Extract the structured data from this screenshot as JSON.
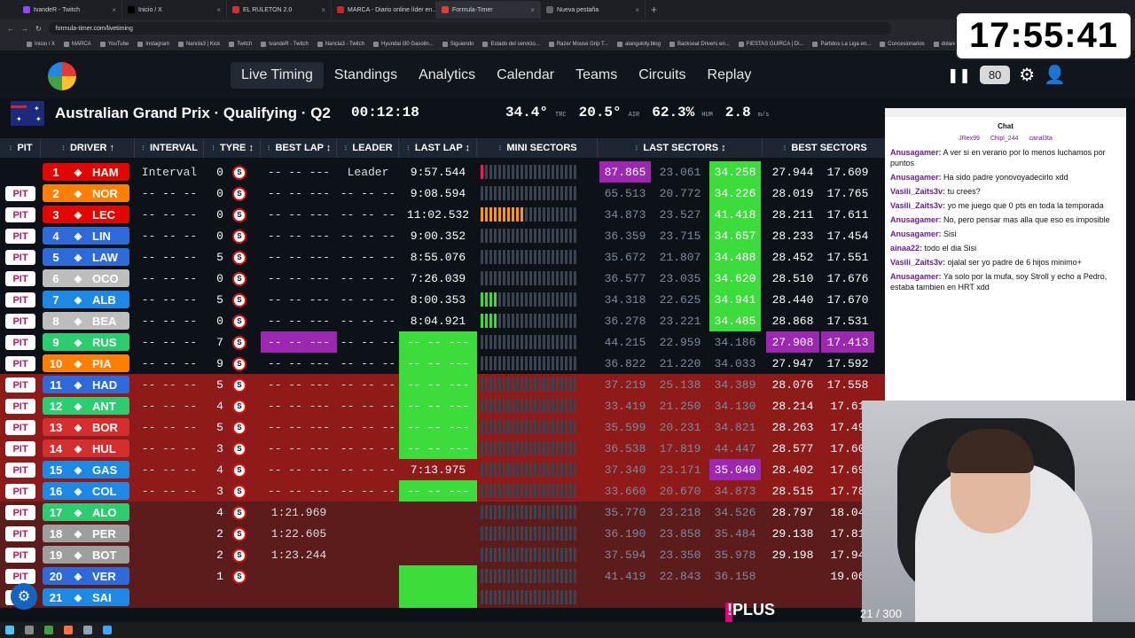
{
  "browser": {
    "tabs": [
      {
        "label": "tvandeR - Twitch",
        "color": "#9146ff",
        "active": false
      },
      {
        "label": "Inicio / X",
        "color": "#000000",
        "active": false
      },
      {
        "label": "EL RULETON 2.0",
        "color": "#d32f2f",
        "active": false
      },
      {
        "label": "MARCA - Diario online líder en...",
        "color": "#c62828",
        "active": false
      },
      {
        "label": "Formula-Timer",
        "color": "#e53935",
        "active": true
      },
      {
        "label": "Nueva pestaña",
        "color": "#5f6368",
        "active": false
      }
    ],
    "url": "formula-timer.com/livetiming",
    "bookmarks": [
      "Inicio / X",
      "MARCA",
      "YouTube",
      "Instagram",
      "Nancla3 | Kick",
      "Twitch",
      "tvandeR - Twitch",
      "Nancla3 - Twitch",
      "Hyundai i30 Gasolin...",
      "Siguiendo",
      "Estado del servicio...",
      "Razer Mouse Grip T...",
      "alanguloty.blog",
      "Backseat Drivers en...",
      "FIESTAS GUIRCA | Di...",
      "Partidos La Liga en...",
      "Concesionarios",
      "dolares"
    ]
  },
  "overlay": {
    "clock": "17:55:41",
    "plus_label": "!PLUS",
    "counter": "21 / 300"
  },
  "nav": {
    "items": [
      "Live Timing",
      "Standings",
      "Analytics",
      "Calendar",
      "Teams",
      "Circuits",
      "Replay"
    ],
    "active": "Live Timing",
    "zoom": "80"
  },
  "session": {
    "title": "Australian Grand Prix · Qualifying · Q2",
    "timer": "00:12:18",
    "weather": [
      {
        "value": "34.4°",
        "unit": "TRC"
      },
      {
        "value": "20.5°",
        "unit": "AIR"
      },
      {
        "value": "62.3%",
        "unit": "HUM"
      },
      {
        "value": "2.8",
        "unit": "m/s"
      }
    ]
  },
  "table": {
    "headers": [
      "PIT",
      "DRIVER ↑",
      "INTERVAL",
      "TYRE ↕",
      "BEST LAP ↕",
      "LEADER",
      "LAST LAP ↕",
      "MINI SECTORS",
      "LAST SECTORS ↕",
      "BEST SECTORS"
    ],
    "rows": [
      {
        "pit": "",
        "pos": "1",
        "code": "HAM",
        "team": "#e10600",
        "interval": "Interval",
        "tyre": "0",
        "best": "-- -- ---",
        "leader": "Leader",
        "last": "9:57.544",
        "ls": [
          "87.865",
          "23.061",
          "34.258"
        ],
        "bs": [
          "27.944",
          "17.609"
        ],
        "bg": "#0d1219",
        "lastbg": "",
        "lsbg": [
          "#9c27b0",
          "",
          ""
        ]
      },
      {
        "pit": "PIT",
        "pos": "2",
        "code": "NOR",
        "team": "#ff8000",
        "interval": "-- -- --",
        "tyre": "0",
        "best": "-- -- ---",
        "leader": "-- -- --",
        "last": "9:08.594",
        "ls": [
          "65.513",
          "20.772",
          "34.226"
        ],
        "bs": [
          "28.019",
          "17.765"
        ],
        "bg": "#0d1219",
        "lastbg": "",
        "lsbg": [
          "",
          "",
          ""
        ]
      },
      {
        "pit": "PIT",
        "pos": "3",
        "code": "LEC",
        "team": "#e10600",
        "interval": "-- -- --",
        "tyre": "0",
        "best": "-- -- ---",
        "leader": "-- -- --",
        "last": "11:02.532",
        "ls": [
          "34.873",
          "23.527",
          "41.418"
        ],
        "bs": [
          "28.211",
          "17.611"
        ],
        "bg": "#0d1219",
        "lastbg": "",
        "lsbg": [
          "",
          "",
          ""
        ]
      },
      {
        "pit": "PIT",
        "pos": "4",
        "code": "LIN",
        "team": "#2e6bd8",
        "interval": "-- -- --",
        "tyre": "0",
        "best": "-- -- ---",
        "leader": "-- -- --",
        "last": "9:00.352",
        "ls": [
          "36.359",
          "23.715",
          "34.657"
        ],
        "bs": [
          "28.233",
          "17.454"
        ],
        "bg": "#0d1219",
        "lastbg": "",
        "lsbg": [
          "",
          "",
          ""
        ]
      },
      {
        "pit": "PIT",
        "pos": "5",
        "code": "LAW",
        "team": "#2e6bd8",
        "interval": "-- -- --",
        "tyre": "5",
        "best": "-- -- ---",
        "leader": "-- -- --",
        "last": "8:55.076",
        "ls": [
          "35.672",
          "21.807",
          "34.488"
        ],
        "bs": [
          "28.452",
          "17.551"
        ],
        "bg": "#0d1219",
        "lastbg": "",
        "lsbg": [
          "",
          "",
          ""
        ]
      },
      {
        "pit": "PIT",
        "pos": "6",
        "code": "OCO",
        "team": "#bdbdbd",
        "interval": "-- -- --",
        "tyre": "0",
        "best": "-- -- ---",
        "leader": "-- -- --",
        "last": "7:26.039",
        "ls": [
          "36.577",
          "23.035",
          "34.620"
        ],
        "bs": [
          "28.510",
          "17.676"
        ],
        "bg": "#0d1219",
        "lastbg": "",
        "lsbg": [
          "",
          "",
          ""
        ]
      },
      {
        "pit": "PIT",
        "pos": "7",
        "code": "ALB",
        "team": "#1e88e5",
        "interval": "-- -- --",
        "tyre": "5",
        "best": "-- -- ---",
        "leader": "-- -- --",
        "last": "8:00.353",
        "ls": [
          "34.318",
          "22.625",
          "34.941"
        ],
        "bs": [
          "28.440",
          "17.670"
        ],
        "bg": "#0d1219",
        "lastbg": "",
        "lsbg": [
          "",
          "",
          ""
        ]
      },
      {
        "pit": "PIT",
        "pos": "8",
        "code": "BEA",
        "team": "#bdbdbd",
        "interval": "-- -- --",
        "tyre": "0",
        "best": "-- -- ---",
        "leader": "-- -- --",
        "last": "8:04.921",
        "ls": [
          "36.278",
          "23.221",
          "34.485"
        ],
        "bs": [
          "28.868",
          "17.531"
        ],
        "bg": "#0d1219",
        "lastbg": "",
        "lsbg": [
          "",
          "",
          ""
        ]
      },
      {
        "pit": "PIT",
        "pos": "9",
        "code": "RUS",
        "team": "#2ecc71",
        "interval": "-- -- --",
        "tyre": "7",
        "best": "-- -- ---",
        "leader": "-- -- --",
        "last": "-- -- ---",
        "ls": [
          "44.215",
          "22.959",
          "34.186"
        ],
        "bs": [
          "27.908",
          "17.413"
        ],
        "bg": "#0d1219",
        "lastbg": "#3ddc3d",
        "lsbg": [
          "",
          "",
          ""
        ]
      },
      {
        "pit": "PIT",
        "pos": "10",
        "code": "PIA",
        "team": "#ff8000",
        "interval": "-- -- --",
        "tyre": "9",
        "best": "-- -- ---",
        "leader": "-- -- --",
        "last": "-- -- ---",
        "ls": [
          "36.822",
          "21.220",
          "34.033"
        ],
        "bs": [
          "27.947",
          "17.592"
        ],
        "bg": "#0d1219",
        "lastbg": "#3ddc3d",
        "lsbg": [
          "",
          "",
          ""
        ]
      },
      {
        "pit": "PIT",
        "pos": "11",
        "code": "HAD",
        "team": "#2e6bd8",
        "interval": "-- -- --",
        "tyre": "5",
        "best": "-- -- ---",
        "leader": "-- -- --",
        "last": "-- -- ---",
        "ls": [
          "37.219",
          "25.138",
          "34.389"
        ],
        "bs": [
          "28.076",
          "17.558"
        ],
        "bg": "#8e1a1a",
        "lastbg": "#3ddc3d",
        "lsbg": [
          "",
          "",
          ""
        ]
      },
      {
        "pit": "PIT",
        "pos": "12",
        "code": "ANT",
        "team": "#2ecc71",
        "interval": "-- -- --",
        "tyre": "4",
        "best": "-- -- ---",
        "leader": "-- -- --",
        "last": "-- -- ---",
        "ls": [
          "33.419",
          "21.250",
          "34.130"
        ],
        "bs": [
          "28.214",
          "17.61"
        ],
        "bg": "#8e1a1a",
        "lastbg": "#3ddc3d",
        "lsbg": [
          "",
          "",
          ""
        ]
      },
      {
        "pit": "PIT",
        "pos": "13",
        "code": "BOR",
        "team": "#d32f2f",
        "interval": "-- -- --",
        "tyre": "5",
        "best": "-- -- ---",
        "leader": "-- -- --",
        "last": "-- -- ---",
        "ls": [
          "35.599",
          "20.231",
          "34.821"
        ],
        "bs": [
          "28.263",
          "17.49"
        ],
        "bg": "#8e1a1a",
        "lastbg": "#3ddc3d",
        "lsbg": [
          "",
          "",
          ""
        ]
      },
      {
        "pit": "PIT",
        "pos": "14",
        "code": "HUL",
        "team": "#d32f2f",
        "interval": "-- -- --",
        "tyre": "3",
        "best": "-- -- ---",
        "leader": "-- -- --",
        "last": "-- -- ---",
        "ls": [
          "36.538",
          "17.819",
          "44.447"
        ],
        "bs": [
          "28.577",
          "17.60"
        ],
        "bg": "#8e1a1a",
        "lastbg": "#3ddc3d",
        "lsbg": [
          "",
          "",
          ""
        ]
      },
      {
        "pit": "PIT",
        "pos": "15",
        "code": "GAS",
        "team": "#1e88e5",
        "interval": "-- -- --",
        "tyre": "4",
        "best": "-- -- ---",
        "leader": "-- -- --",
        "last": "7:13.975",
        "ls": [
          "37.340",
          "23.171",
          "35.040"
        ],
        "bs": [
          "28.402",
          "17.69"
        ],
        "bg": "#8e1a1a",
        "lastbg": "",
        "lsbg": [
          "",
          "",
          "#9c27b0"
        ]
      },
      {
        "pit": "PIT",
        "pos": "16",
        "code": "COL",
        "team": "#1e88e5",
        "interval": "-- -- --",
        "tyre": "3",
        "best": "-- -- ---",
        "leader": "-- -- --",
        "last": "-- -- ---",
        "ls": [
          "33.660",
          "20.670",
          "34.873"
        ],
        "bs": [
          "28.515",
          "17.78"
        ],
        "bg": "#8e1a1a",
        "lastbg": "#3ddc3d",
        "lsbg": [
          "",
          "",
          ""
        ]
      },
      {
        "pit": "PIT",
        "pos": "17",
        "code": "ALO",
        "team": "#2ecc71",
        "interval": "",
        "tyre": "4",
        "best": "1:21.969",
        "leader": "",
        "last": "",
        "ls": [
          "35.770",
          "23.218",
          "34.526"
        ],
        "bs": [
          "28.797",
          "18.04"
        ],
        "bg": "#5c1c1c",
        "lastbg": "",
        "lsbg": [
          "",
          "",
          ""
        ]
      },
      {
        "pit": "PIT",
        "pos": "18",
        "code": "PER",
        "team": "#9e9e9e",
        "interval": "",
        "tyre": "2",
        "best": "1:22.605",
        "leader": "",
        "last": "",
        "ls": [
          "36.190",
          "23.858",
          "35.484"
        ],
        "bs": [
          "29.138",
          "17.81"
        ],
        "bg": "#5c1c1c",
        "lastbg": "",
        "lsbg": [
          "",
          "",
          ""
        ]
      },
      {
        "pit": "PIT",
        "pos": "19",
        "code": "BOT",
        "team": "#9e9e9e",
        "interval": "",
        "tyre": "2",
        "best": "1:23.244",
        "leader": "",
        "last": "",
        "ls": [
          "37.594",
          "23.350",
          "35.978"
        ],
        "bs": [
          "29.198",
          "17.94"
        ],
        "bg": "#5c1c1c",
        "lastbg": "",
        "lsbg": [
          "",
          "",
          ""
        ]
      },
      {
        "pit": "PIT",
        "pos": "20",
        "code": "VER",
        "team": "#2e6bd8",
        "interval": "",
        "tyre": "1",
        "best": "",
        "leader": "",
        "last": "",
        "ls": [
          "41.419",
          "22.843",
          "36.158"
        ],
        "bs": [
          "",
          "19.06"
        ],
        "bg": "#5c1c1c",
        "lastbg": "#3ddc3d",
        "lsbg": [
          "",
          "",
          ""
        ]
      },
      {
        "pit": "PIT",
        "pos": "21",
        "code": "SAI",
        "team": "#1e88e5",
        "interval": "",
        "tyre": "",
        "best": "",
        "leader": "",
        "last": "",
        "ls": [
          "",
          "",
          ""
        ],
        "bs": [
          "",
          ""
        ],
        "bg": "#5c1c1c",
        "lastbg": "#3ddc3d",
        "lsbg": [
          "",
          "",
          ""
        ]
      }
    ]
  },
  "chat": {
    "title": "Chat",
    "top": [
      "JRex99",
      "Chipl_244",
      "canal3ta"
    ],
    "messages": [
      {
        "user": "Anusagamer:",
        "text": "A ver si en verano por lo menos luchamos por puntos"
      },
      {
        "user": "Anusagamer:",
        "text": "Ha sido padre yonovoyadecirlo xdd"
      },
      {
        "user": "Vasili_Zaits3v:",
        "text": "tu crees?"
      },
      {
        "user": "Vasili_Zaits3v:",
        "text": "yo me juego que 0 pts en toda la temporada"
      },
      {
        "user": "Anusagamer:",
        "text": "No, pero pensar mas alla que eso es imposible"
      },
      {
        "user": "Anusagamer:",
        "text": "Sisi"
      },
      {
        "user": "ainaa22:",
        "text": "todo el dia Sisi"
      },
      {
        "user": "Vasili_Zaits3v:",
        "text": "ojalal ser yo padre de 6 hijos minimo+"
      },
      {
        "user": "Anusagamer:",
        "text": "Ya solo por la mufa, soy Stroll y echo a Pedro, estaba tambien en HRT xdd"
      }
    ]
  }
}
